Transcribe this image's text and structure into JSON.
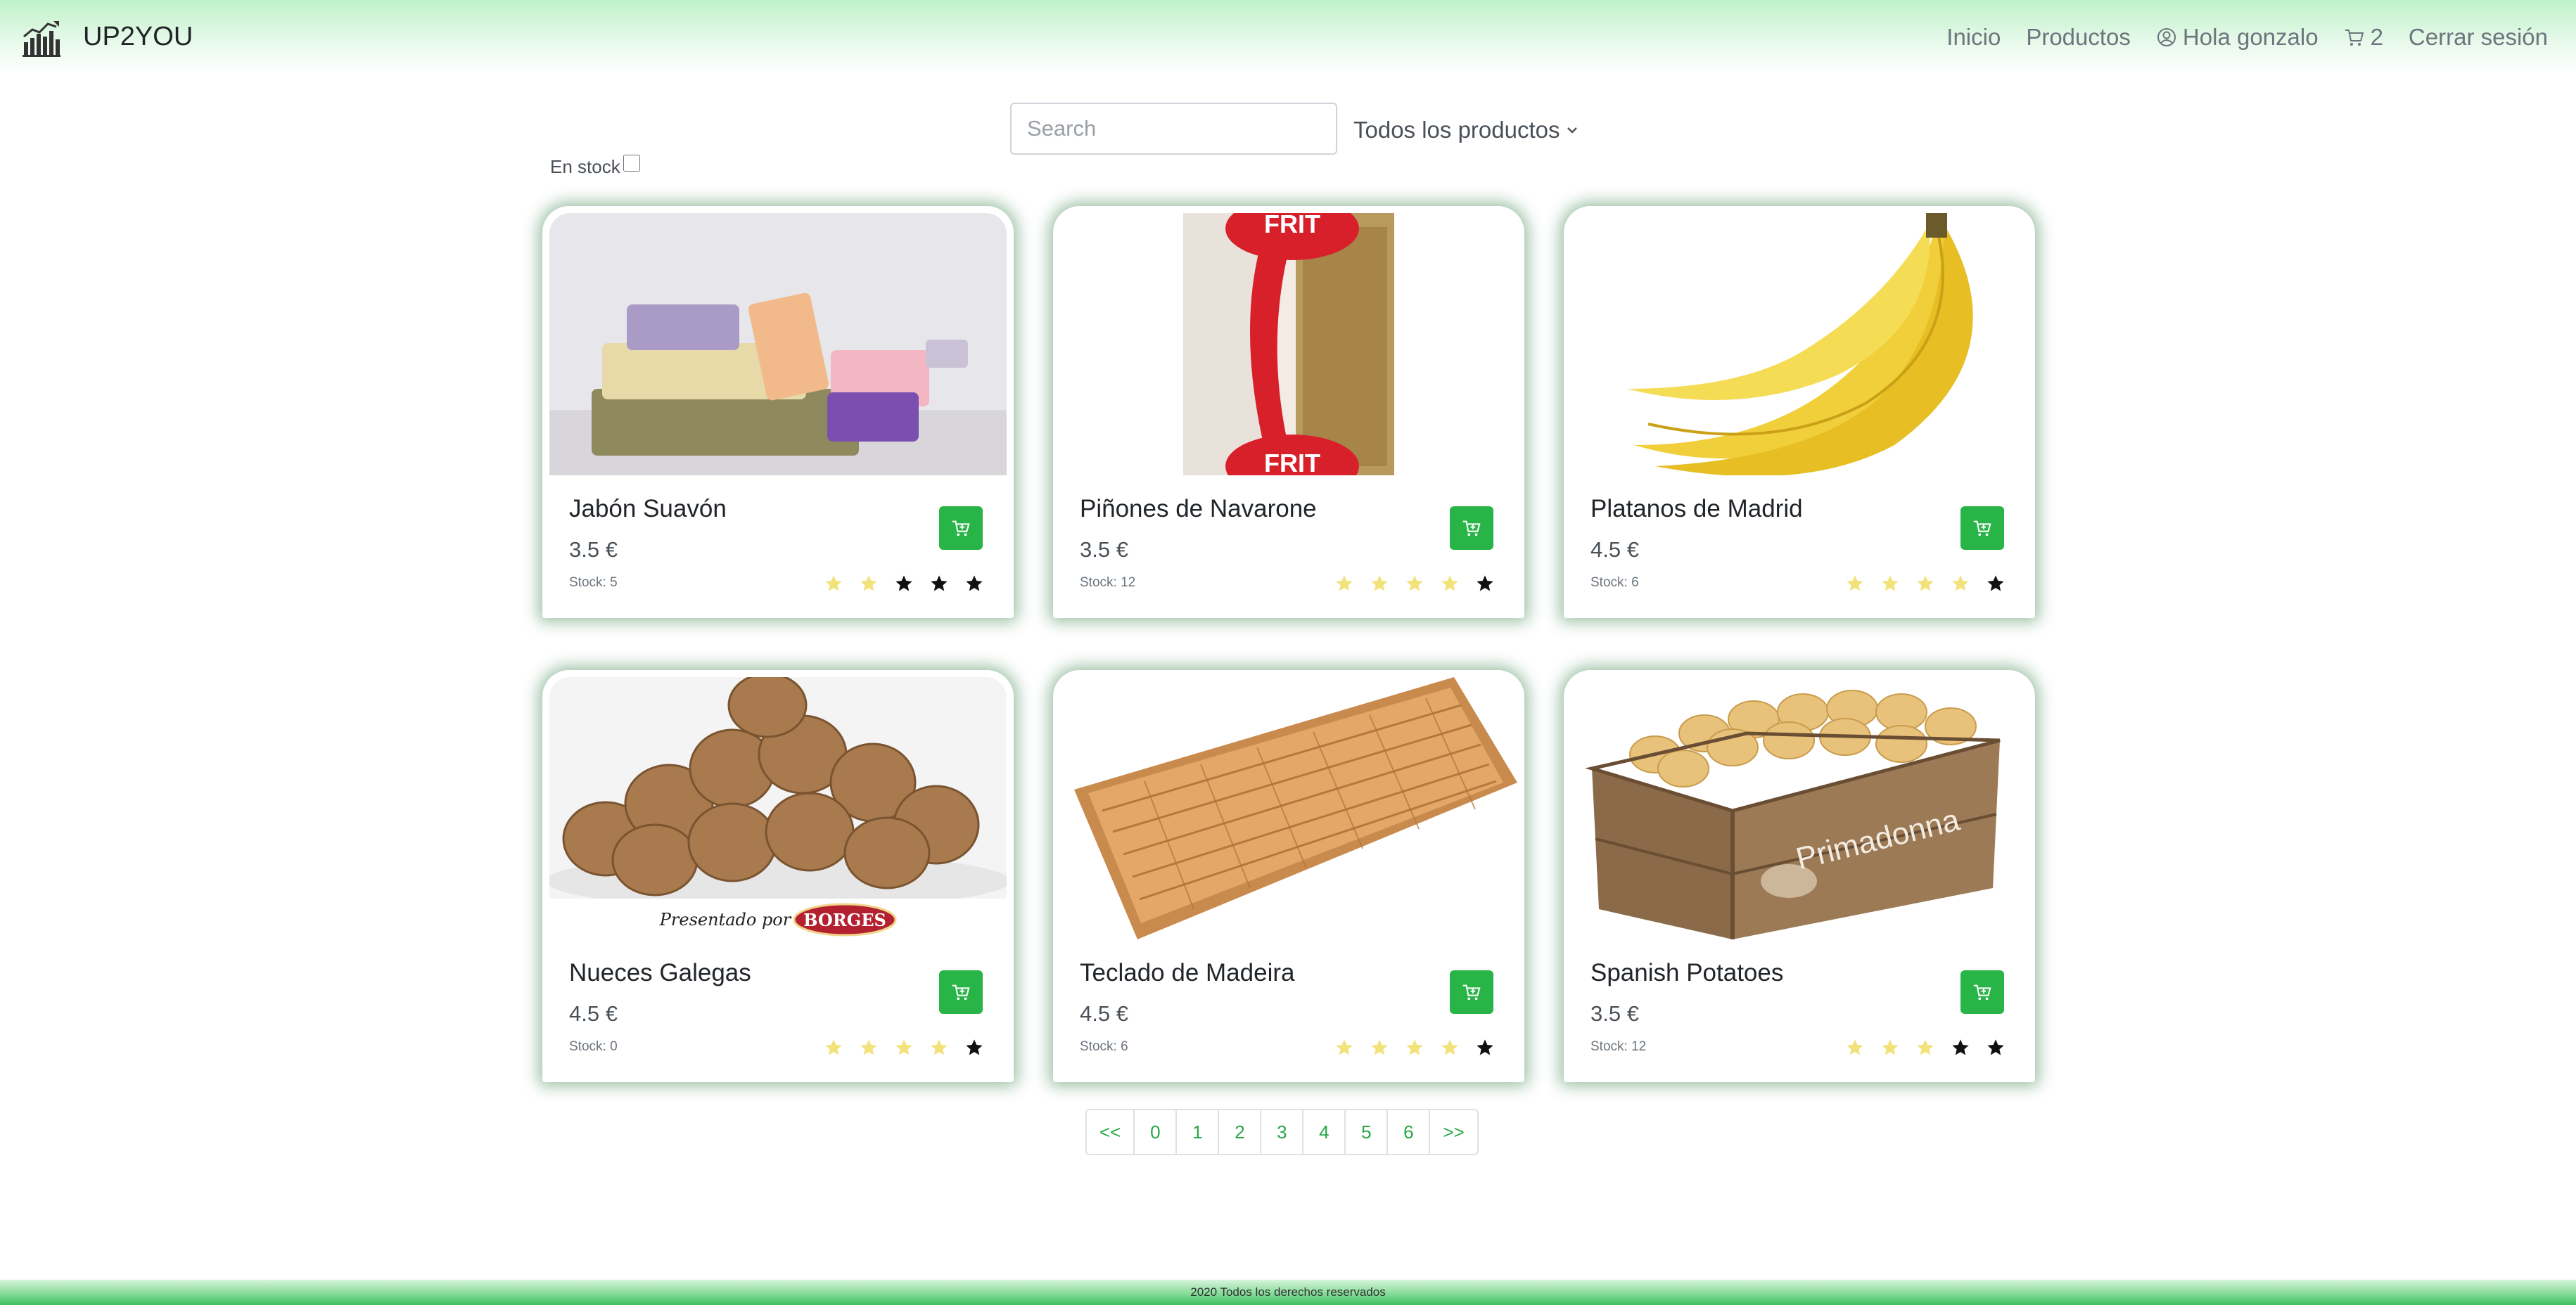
{
  "brand": {
    "name": "UP2YOU"
  },
  "nav": {
    "inicio": "Inicio",
    "productos": "Productos",
    "user": "Hola gonzalo",
    "cart_count": "2",
    "logout": "Cerrar sesión"
  },
  "filters": {
    "search_placeholder": "Search",
    "category": "Todos los productos",
    "in_stock_label": "En stock",
    "in_stock_checked": false
  },
  "products": [
    {
      "name": "Jabón Suavón",
      "price": "3.5 €",
      "stock": "Stock: 5",
      "rating": 2,
      "image": "soap-bars"
    },
    {
      "name": "Piñones de Navarone",
      "price": "3.5 €",
      "stock": "Stock: 12",
      "rating": 4,
      "image": "nuts-bag"
    },
    {
      "name": "Platanos de Madrid",
      "price": "4.5 €",
      "stock": "Stock: 6",
      "rating": 4,
      "image": "bananas"
    },
    {
      "name": "Nueces Galegas",
      "price": "4.5 €",
      "stock": "Stock: 0",
      "rating": 4,
      "image": "walnuts",
      "image_caption": "Presentado por",
      "image_brand": "BORGES"
    },
    {
      "name": "Teclado de Madeira",
      "price": "4.5 €",
      "stock": "Stock: 6",
      "rating": 4,
      "image": "wooden-keyboard"
    },
    {
      "name": "Spanish Potatoes",
      "price": "3.5 €",
      "stock": "Stock: 12",
      "rating": 3,
      "image": "potato-crate",
      "image_brand": "Primadonna"
    }
  ],
  "pagination": [
    "<<",
    "0",
    "1",
    "2",
    "3",
    "4",
    "5",
    "6",
    ">>"
  ],
  "footer": {
    "text": "2020 Todos los derechos reservados"
  },
  "colors": {
    "accent": "#28b447",
    "star_filled": "#f2e27a",
    "star_empty": "#111111",
    "nav_gradient": "#bff2c8",
    "footer_gradient": "#3fc15f"
  }
}
